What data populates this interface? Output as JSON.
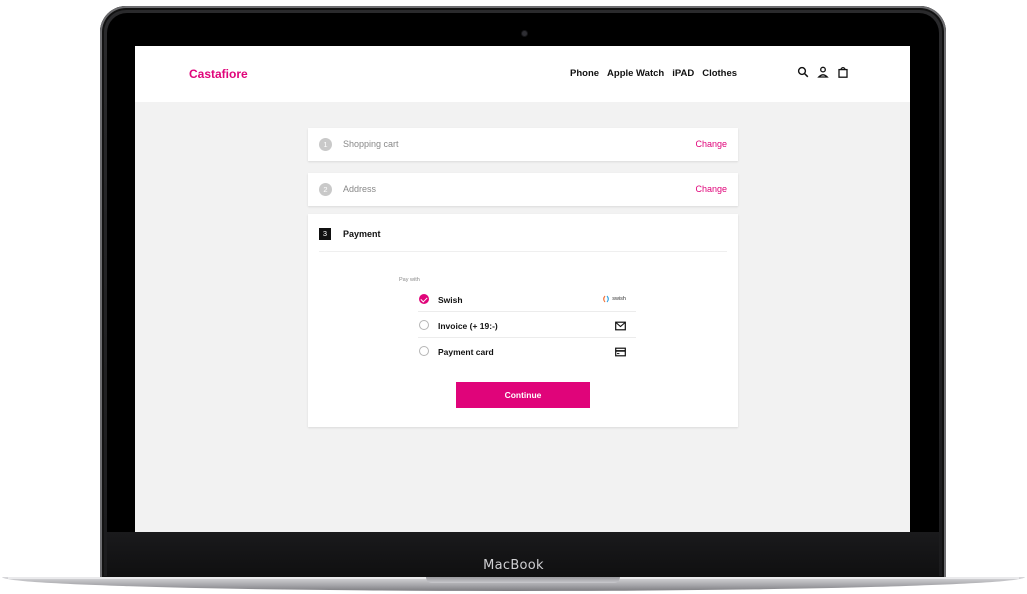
{
  "device_label": "MacBook",
  "header": {
    "logo": "Castafiore",
    "nav": [
      "Phone",
      "Apple Watch",
      "iPAD",
      "Clothes"
    ],
    "icons": [
      "search-icon",
      "user-icon",
      "shopping-bag-icon"
    ]
  },
  "steps": [
    {
      "number": "1",
      "title": "Shopping cart",
      "action": "Change"
    },
    {
      "number": "2",
      "title": "Address",
      "action": "Change"
    }
  ],
  "payment": {
    "number": "3",
    "title": "Payment",
    "pay_with_label": "Pay with",
    "options": [
      {
        "label": "Swish",
        "selected": true,
        "icon": "swish-logo",
        "icon_text": "swish"
      },
      {
        "label": "Invoice (+ 19:-)",
        "selected": false,
        "icon": "envelope-icon"
      },
      {
        "label": "Payment card",
        "selected": false,
        "icon": "credit-card-icon"
      }
    ],
    "continue_label": "Continue"
  },
  "colors": {
    "accent": "#e0047a",
    "background": "#f2f2f2"
  }
}
